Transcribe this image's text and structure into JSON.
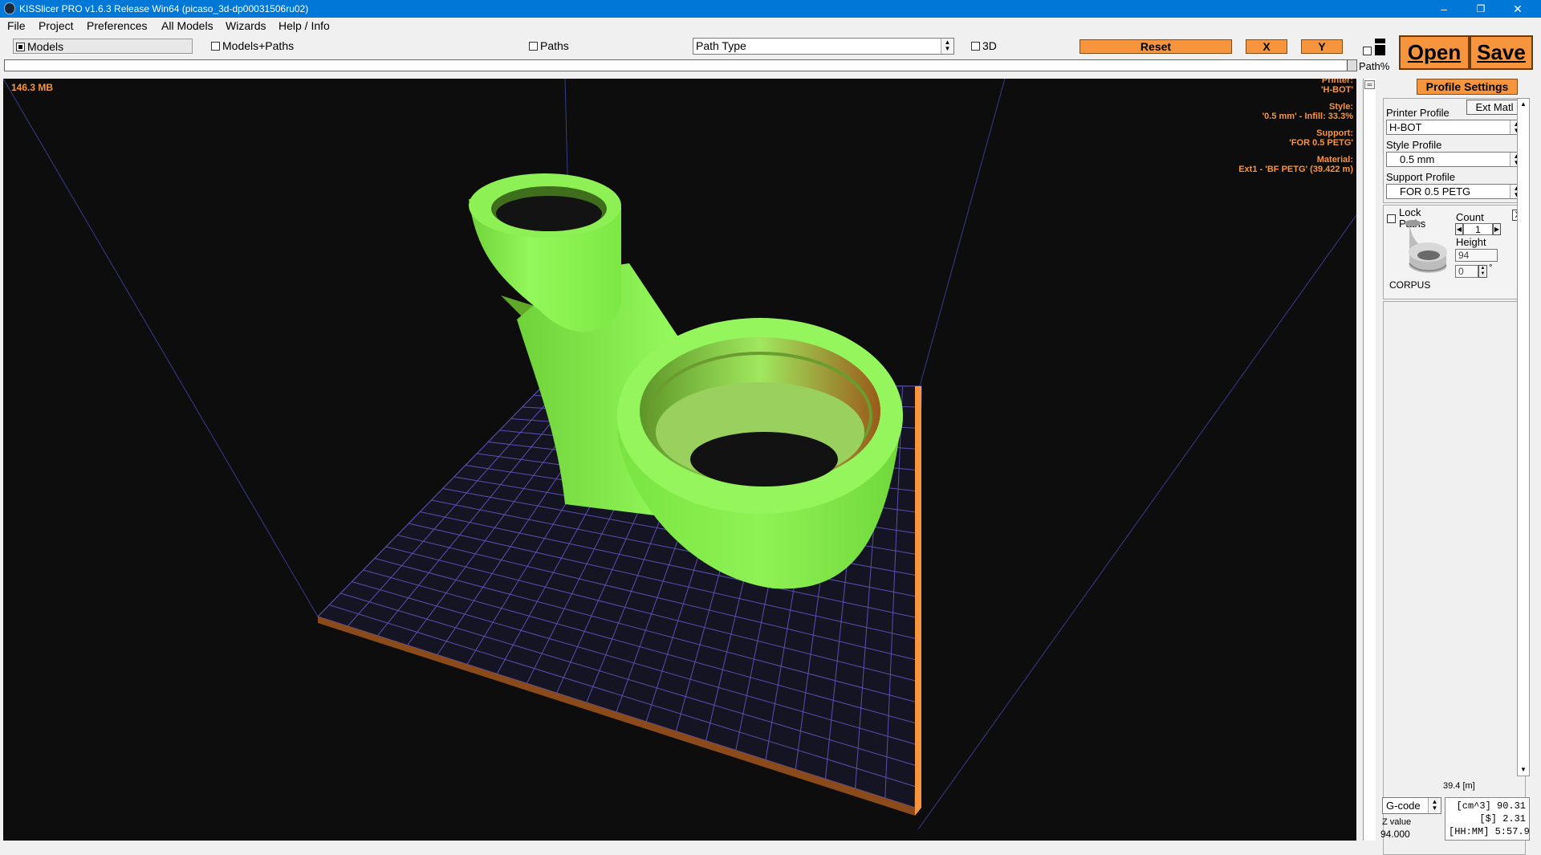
{
  "window": {
    "title": "KISSlicer PRO v1.6.3 Release Win64 (picaso_3d-dp00031506ru02)",
    "controls": [
      "–",
      "❐",
      "✕"
    ]
  },
  "menu": [
    "File",
    "Project",
    "Preferences",
    "All Models",
    "Wizards",
    "Help / Info"
  ],
  "toolbar": {
    "models_label": "Models",
    "models_checked": true,
    "models_paths_label": "Models+Paths",
    "paths_label": "Paths",
    "path_type_value": "Path Type",
    "three_d_label": "3D",
    "reset_label": "Reset",
    "x_label": "X",
    "y_label": "Y",
    "open_label": "Open",
    "save_label": "Save",
    "path_pct_label": "Path%"
  },
  "viewport": {
    "memory": "146.3 MB",
    "printer_label": "Printer:",
    "printer_value": "'H-BOT'",
    "style_label": "Style:",
    "style_value": "'0.5 mm' - Infill: 33.3%",
    "support_label": "Support:",
    "support_value": "'FOR 0.5 PETG'",
    "material_label": "Material:",
    "material_value": "Ext1 - 'BF PETG' (39.422 m)"
  },
  "panel": {
    "profile_settings_label": "Profile Settings",
    "ext_matl_label": "Ext Matl",
    "printer_profile_label": "Printer Profile",
    "printer_profile_value": "H-BOT",
    "style_profile_label": "Style Profile",
    "style_profile_value": "0.5 mm",
    "support_profile_label": "Support Profile",
    "support_profile_value": "FOR 0.5 PETG",
    "lock_paths_label": "Lock Paths",
    "count_label": "Count",
    "count_value": "1",
    "height_label": "Height",
    "height_value": "94",
    "rotation_value": "0",
    "degree_symbol": "°",
    "remove_label": "X",
    "model_name": "CORPUS",
    "length_value": "39.4 [m]",
    "gcode_label": "G-code",
    "z_value_label": "Z value",
    "z_value": "94.000"
  },
  "stats": {
    "volume": "[cm^3] 90.31",
    "cost": "[$] 2.31",
    "time": "[HH:MM] 5:57.9"
  },
  "colors": {
    "accent_orange": "#f7953f",
    "model_green": "#86f24a",
    "viewport_bg": "#0d0d0d",
    "grid_line": "#5a4fb0",
    "titlebar": "#0078d7"
  }
}
